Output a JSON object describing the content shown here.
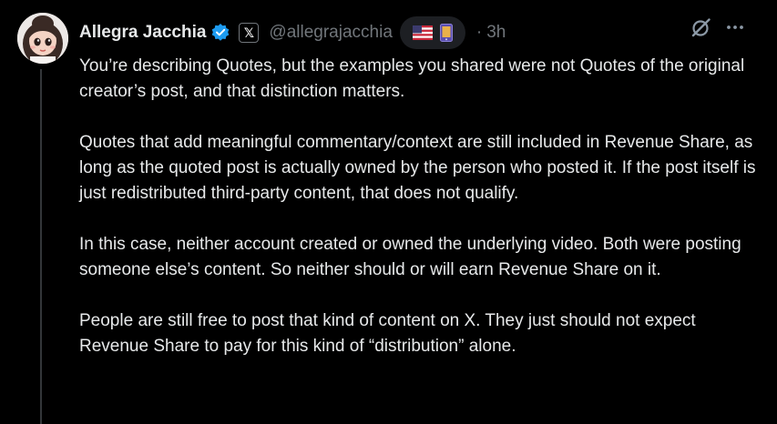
{
  "author": {
    "name": "Allegra Jacchia",
    "handle": "@allegrajacchia",
    "time_sep": "·",
    "time": "3h"
  },
  "icons": {
    "verified": "verified-badge-icon",
    "affiliate": "x-logo-icon",
    "affiliate_glyph": "𝕏",
    "emoji_1": "us-flag-icon",
    "emoji_2": "mobile-phone-icon",
    "grok": "grok-icon",
    "more": "more-icon"
  },
  "colors": {
    "background": "#000000",
    "text": "#e7e9ea",
    "muted": "#71767b",
    "verified": "#1d9bf0",
    "thread_line": "#333639"
  },
  "paragraphs": [
    "You’re describing Quotes, but the examples you shared were not Quotes of the original creator’s post, and that distinction matters.",
    "Quotes that add meaningful commentary/context are still included in Revenue Share, as long as the quoted post is actually owned by the person who posted it. If the post itself is just redistributed third-party content, that does not qualify.",
    "In this case, neither account created or owned the underlying video. Both were posting someone else’s content. So neither should or will earn Revenue Share on it.",
    "People are still free to post that kind of content on X. They just should not expect Revenue Share to pay for this kind of “distribution” alone."
  ]
}
